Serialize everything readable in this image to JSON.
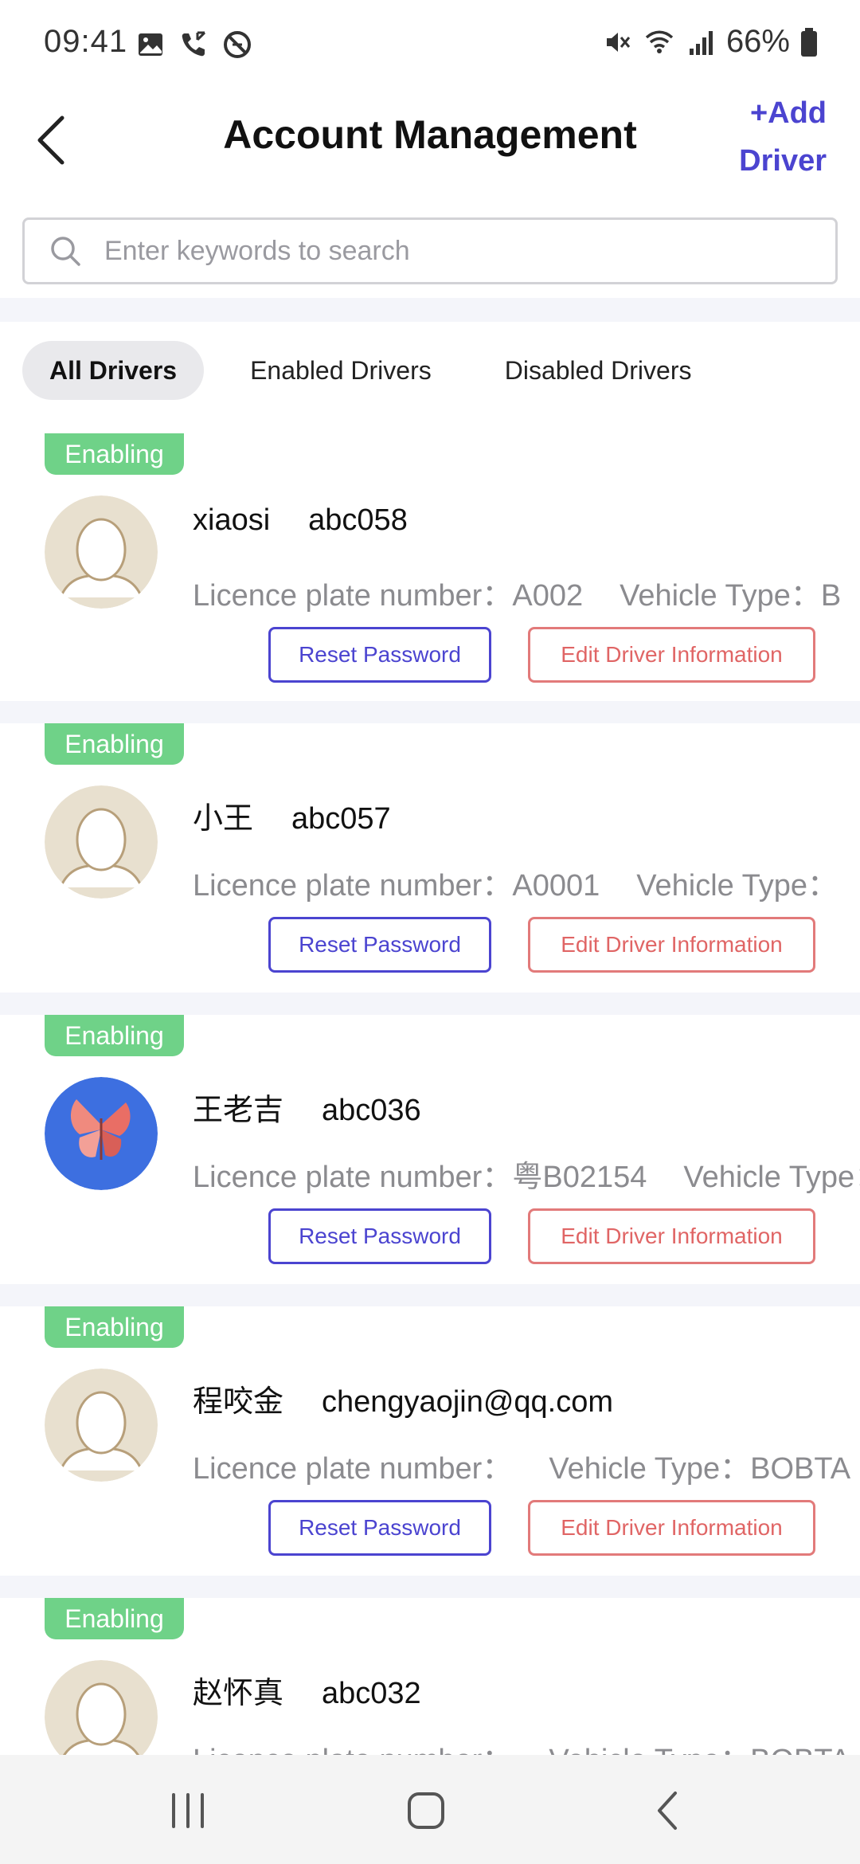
{
  "status_bar": {
    "time": "09:41",
    "battery": "66%",
    "left_icons": [
      "gallery-icon",
      "call-icon",
      "blocked-icon"
    ],
    "right_icons": [
      "mute-icon",
      "wifi-icon",
      "signal-icon",
      "battery-icon"
    ]
  },
  "header": {
    "title": "Account Management",
    "add_driver_line1": "+Add",
    "add_driver_line2": "Driver"
  },
  "search": {
    "placeholder": "Enter keywords to search",
    "value": ""
  },
  "tabs": [
    {
      "label": "All Drivers",
      "active": true
    },
    {
      "label": "Enabled Drivers",
      "active": false
    },
    {
      "label": "Disabled Drivers",
      "active": false
    }
  ],
  "labels": {
    "plate": "Licence plate number：",
    "vehicle_type": "Vehicle Type：",
    "reset_password": "Reset Password",
    "edit_driver": "Edit Driver Information"
  },
  "drivers": [
    {
      "status": "Enabling",
      "name": "xiaosi",
      "account": "abc058",
      "plate": "A002",
      "vehicle_type": "B",
      "avatar": "default-avatar"
    },
    {
      "status": "Enabling",
      "name": "小王",
      "account": "abc057",
      "plate": "A0001",
      "vehicle_type": "",
      "avatar": "default-avatar"
    },
    {
      "status": "Enabling",
      "name": "王老吉",
      "account": "abc036",
      "plate": "粤B02154",
      "vehicle_type": "",
      "avatar": "butterfly-avatar"
    },
    {
      "status": "Enabling",
      "name": "程咬金",
      "account": "chengyaojin@qq.com",
      "plate": "",
      "vehicle_type": "BOBTA",
      "avatar": "default-avatar"
    },
    {
      "status": "Enabling",
      "name": "赵怀真",
      "account": "abc032",
      "plate": "",
      "vehicle_type": "BOBTA",
      "avatar": "default-avatar"
    }
  ],
  "navbar": [
    "recent-apps-icon",
    "home-icon",
    "back-icon"
  ],
  "colors": {
    "accent": "#4b44d0",
    "badge_green": "#6fd288",
    "edit_red": "#e06565",
    "band_gray": "#f4f5fa"
  }
}
